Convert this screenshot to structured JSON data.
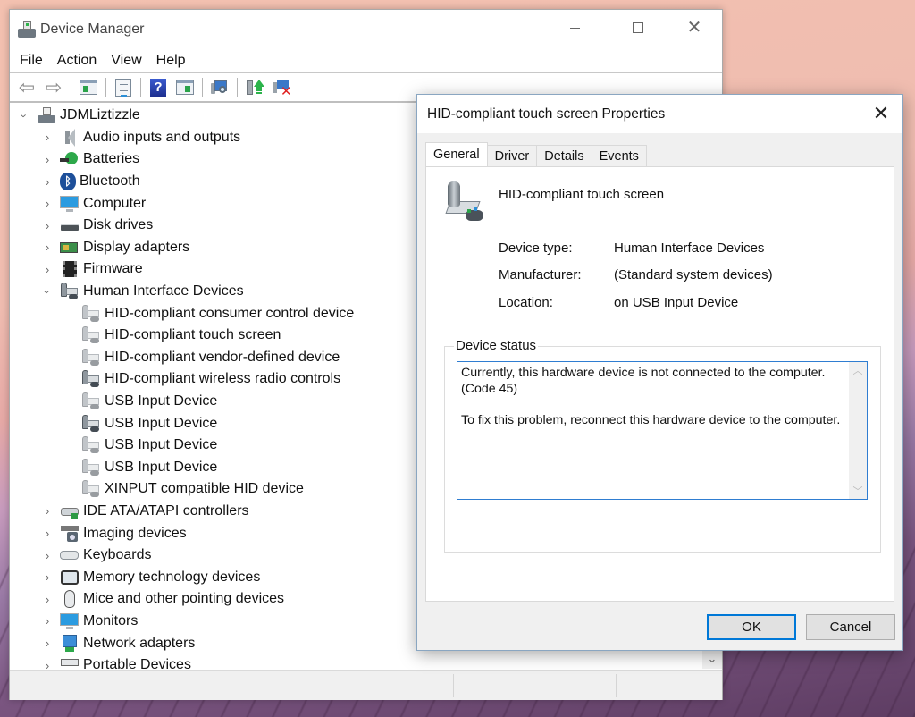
{
  "device_manager": {
    "title": "Device Manager",
    "menu": [
      "File",
      "Action",
      "View",
      "Help"
    ],
    "toolbar": [
      {
        "icon": "back-arrow-icon",
        "tooltip": "Back"
      },
      {
        "icon": "forward-arrow-icon",
        "tooltip": "Forward"
      },
      {
        "icon": "show-hide-console-tree-icon"
      },
      {
        "icon": "properties-icon"
      },
      {
        "icon": "help-icon",
        "glyph": "?"
      },
      {
        "icon": "show-action-pane-icon"
      },
      {
        "icon": "scan-hardware-changes-icon"
      },
      {
        "icon": "update-driver-icon"
      },
      {
        "icon": "uninstall-device-icon"
      }
    ],
    "tree": {
      "root": "JDMLiztizzle",
      "categories": [
        {
          "label": "Audio inputs and outputs",
          "icon": "audio-icon",
          "expanded": false
        },
        {
          "label": "Batteries",
          "icon": "battery-icon",
          "expanded": false
        },
        {
          "label": "Bluetooth",
          "icon": "bluetooth-icon",
          "expanded": false
        },
        {
          "label": "Computer",
          "icon": "computer-icon",
          "expanded": false
        },
        {
          "label": "Disk drives",
          "icon": "disk-drive-icon",
          "expanded": false
        },
        {
          "label": "Display adapters",
          "icon": "display-adapter-icon",
          "expanded": false
        },
        {
          "label": "Firmware",
          "icon": "firmware-icon",
          "expanded": false
        },
        {
          "label": "Human Interface Devices",
          "icon": "hid-icon",
          "expanded": true,
          "children": [
            {
              "label": "HID-compliant consumer control device",
              "hidden_device": true
            },
            {
              "label": "HID-compliant touch screen",
              "hidden_device": true
            },
            {
              "label": "HID-compliant vendor-defined device",
              "hidden_device": true
            },
            {
              "label": "HID-compliant wireless radio controls",
              "hidden_device": false
            },
            {
              "label": "USB Input Device",
              "hidden_device": true
            },
            {
              "label": "USB Input Device",
              "hidden_device": false
            },
            {
              "label": "USB Input Device",
              "hidden_device": true
            },
            {
              "label": "USB Input Device",
              "hidden_device": true
            },
            {
              "label": "XINPUT compatible HID device",
              "hidden_device": true
            }
          ]
        },
        {
          "label": "IDE ATA/ATAPI controllers",
          "icon": "ide-controller-icon",
          "expanded": false
        },
        {
          "label": "Imaging devices",
          "icon": "imaging-device-icon",
          "expanded": false
        },
        {
          "label": "Keyboards",
          "icon": "keyboard-icon",
          "expanded": false
        },
        {
          "label": "Memory technology devices",
          "icon": "memory-device-icon",
          "expanded": false
        },
        {
          "label": "Mice and other pointing devices",
          "icon": "mouse-icon",
          "expanded": false
        },
        {
          "label": "Monitors",
          "icon": "monitor-icon",
          "expanded": false
        },
        {
          "label": "Network adapters",
          "icon": "network-adapter-icon",
          "expanded": false
        },
        {
          "label": "Portable Devices",
          "icon": "portable-device-icon",
          "expanded": false
        }
      ]
    }
  },
  "properties_dialog": {
    "title": "HID-compliant touch screen Properties",
    "tabs": [
      "General",
      "Driver",
      "Details",
      "Events"
    ],
    "active_tab": "General",
    "device_name": "HID-compliant touch screen",
    "properties": [
      {
        "label": "Device type:",
        "value": "Human Interface Devices"
      },
      {
        "label": "Manufacturer:",
        "value": "(Standard system devices)"
      },
      {
        "label": "Location:",
        "value": "on USB Input Device"
      }
    ],
    "status_group_label": "Device status",
    "status_text": "Currently, this hardware device is not connected to the computer. (Code 45)\n\nTo fix this problem, reconnect this hardware device to the computer.",
    "buttons": {
      "ok": "OK",
      "cancel": "Cancel"
    }
  }
}
